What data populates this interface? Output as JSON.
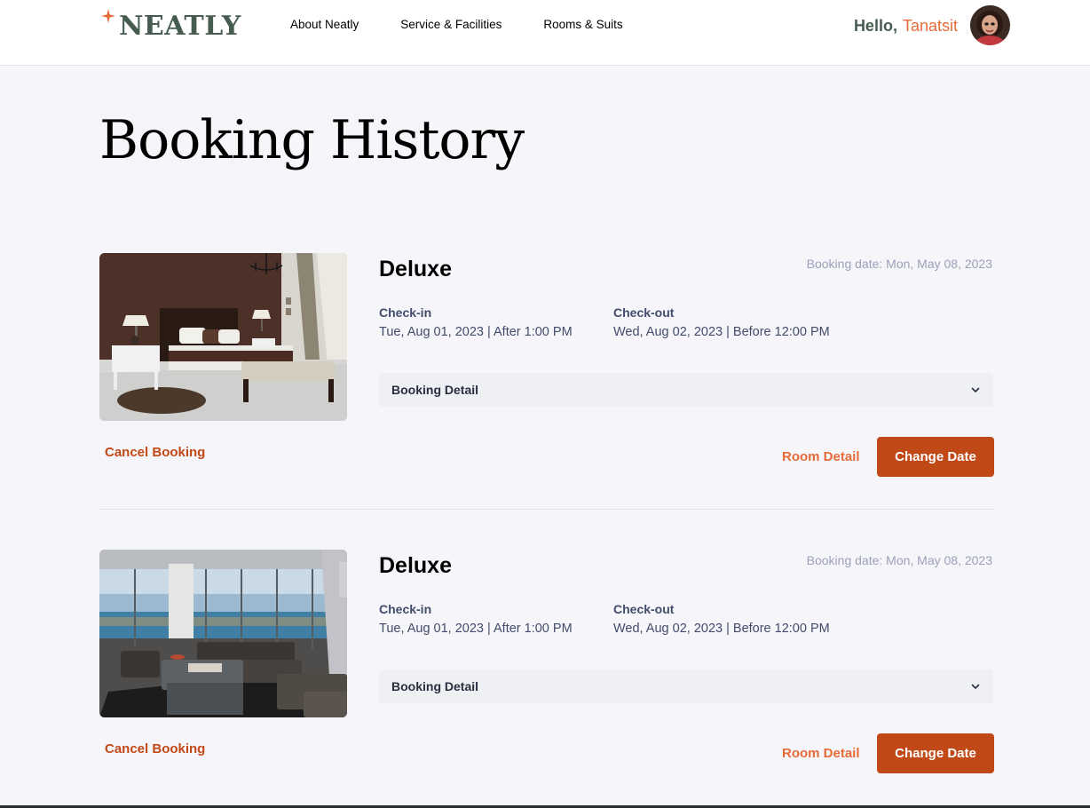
{
  "header": {
    "logo_text": "NEATLY",
    "nav": [
      "About Neatly",
      "Service & Facilities",
      "Rooms & Suits"
    ],
    "greeting": "Hello,",
    "user_name": "Tanatsit"
  },
  "page_title": "Booking History",
  "bookings": [
    {
      "room_name": "Deluxe",
      "booking_date": "Booking date: Mon, May 08, 2023",
      "checkin_label": "Check-in",
      "checkin_value": "Tue, Aug 01, 2023 | After 1:00 PM",
      "checkout_label": "Check-out",
      "checkout_value": "Wed, Aug 02, 2023 | Before 12:00 PM",
      "detail_label": "Booking Detail",
      "cancel_label": "Cancel Booking",
      "room_detail_label": "Room Detail",
      "change_date_label": "Change Date"
    },
    {
      "room_name": "Deluxe",
      "booking_date": "Booking date: Mon, May 08, 2023",
      "checkin_label": "Check-in",
      "checkin_value": "Tue, Aug 01, 2023 | After 1:00 PM",
      "checkout_label": "Check-out",
      "checkout_value": "Wed, Aug 02, 2023 | Before 12:00 PM",
      "detail_label": "Booking Detail",
      "cancel_label": "Cancel Booking",
      "room_detail_label": "Room Detail",
      "change_date_label": "Change Date"
    }
  ],
  "colors": {
    "brand_green": "#465c50",
    "accent_orange": "#e76b39",
    "button_orange": "#c14817",
    "background": "#f6f5f9"
  }
}
